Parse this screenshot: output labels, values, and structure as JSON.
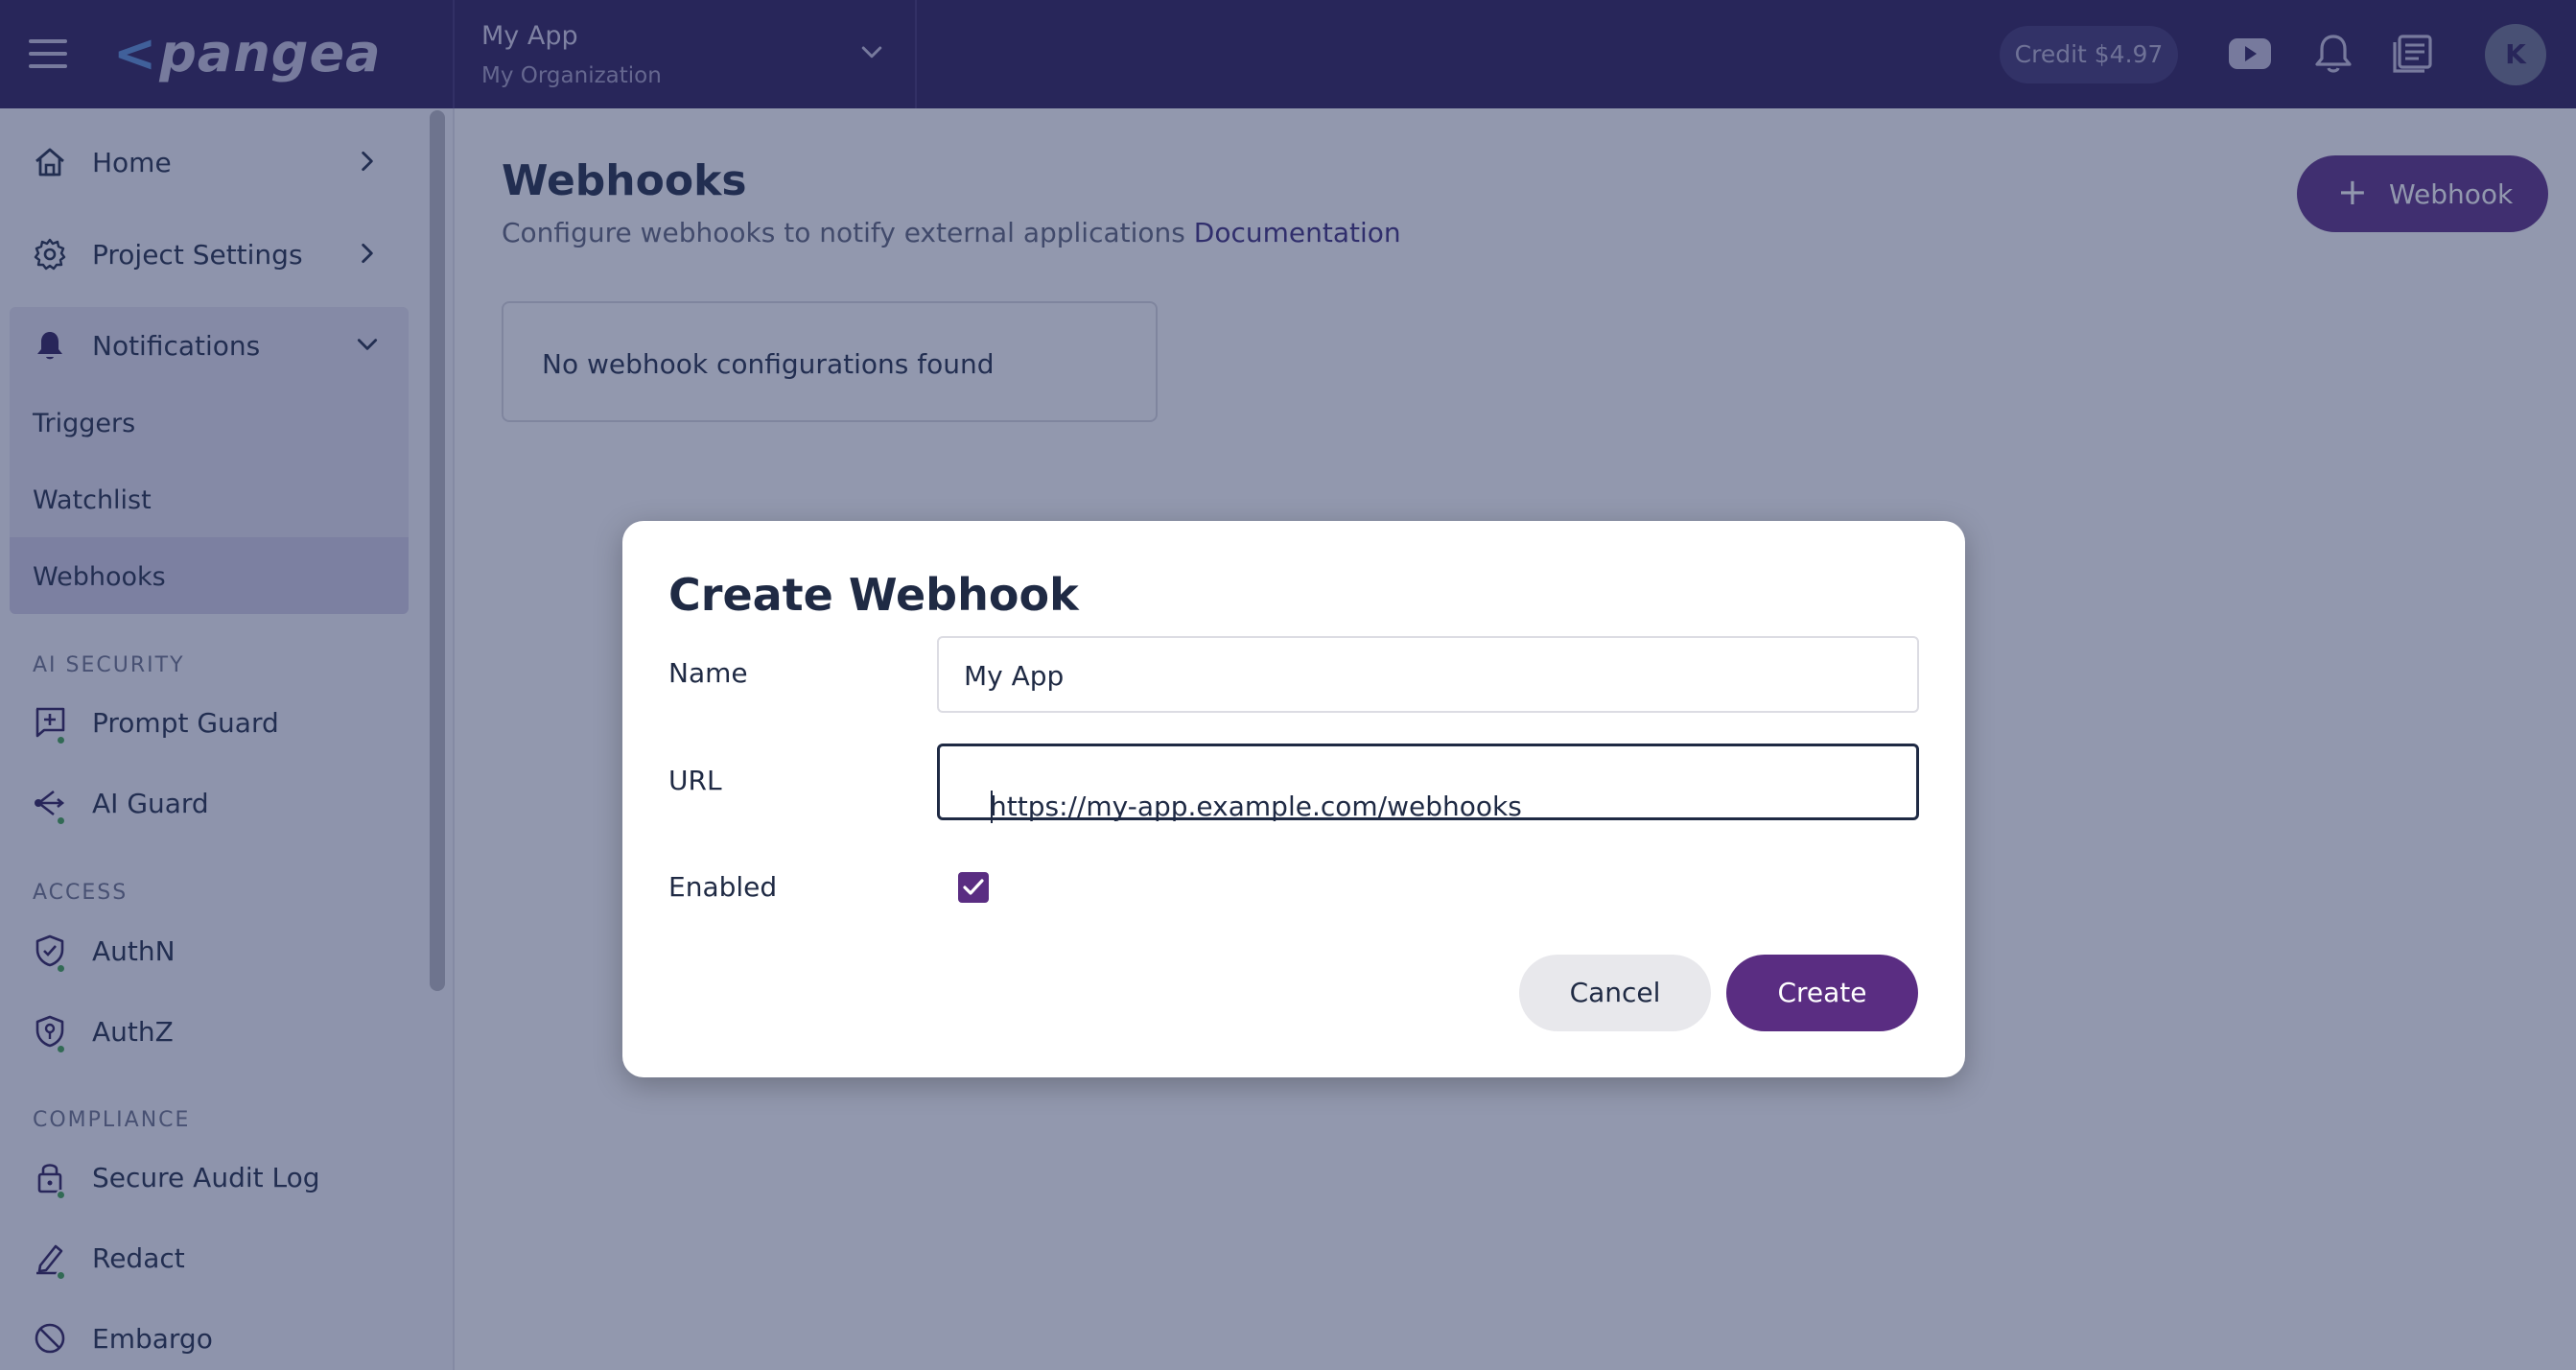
{
  "app": {
    "logo_text": "pangea",
    "project_name": "My App",
    "organization_name": "My Organization",
    "credit": "Credit $4.97",
    "avatar_initial": "K"
  },
  "sidebar": {
    "home": "Home",
    "project_settings": "Project Settings",
    "notifications": "Notifications",
    "notification_items": [
      "Triggers",
      "Watchlist",
      "Webhooks"
    ],
    "sections": {
      "ai_security": "AI SECURITY",
      "access": "ACCESS",
      "compliance": "COMPLIANCE"
    },
    "ai_security_items": [
      "Prompt Guard",
      "AI Guard"
    ],
    "access_items": [
      "AuthN",
      "AuthZ"
    ],
    "compliance_items": [
      "Secure Audit Log",
      "Redact",
      "Embargo"
    ]
  },
  "main": {
    "title": "Webhooks",
    "description": "Configure webhooks to notify external applications",
    "doc_link": "Documentation",
    "add_button": "Webhook",
    "empty_message": "No webhook configurations found"
  },
  "dialog": {
    "title": "Create Webhook",
    "name_label": "Name",
    "name_value": "My App",
    "url_label": "URL",
    "url_value": "https://my-app.example.com/webhooks",
    "enabled_label": "Enabled",
    "enabled": true,
    "cancel": "Cancel",
    "create": "Create"
  },
  "colors": {
    "brand": "#2b1b57",
    "accent": "#5a2d82",
    "status_dot": "#3fa34d"
  }
}
